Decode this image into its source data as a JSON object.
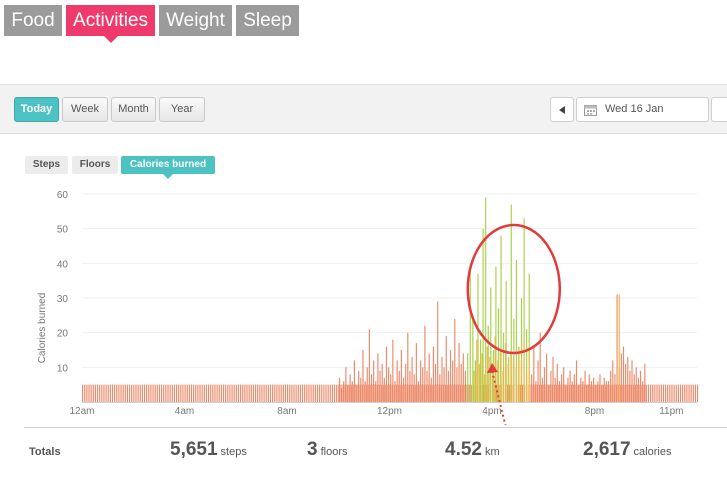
{
  "top_tabs": [
    {
      "label": "Food"
    },
    {
      "label": "Activities",
      "active": true
    },
    {
      "label": "Weight"
    },
    {
      "label": "Sleep"
    }
  ],
  "toolbar": {
    "ranges": [
      "Today",
      "Week",
      "Month",
      "Year"
    ],
    "active_range": "Today",
    "date": "Wed 16 Jan"
  },
  "metric_tabs": [
    "Steps",
    "Floors",
    "Calories burned"
  ],
  "active_metric": "Calories burned",
  "chart_data": {
    "type": "bar",
    "ylabel": "Calories burned",
    "y_ticks": [
      "10",
      "20",
      "30",
      "40",
      "50",
      "60"
    ],
    "ylim": [
      0,
      60
    ],
    "x_tick_labels": [
      "12am",
      "4am",
      "8am",
      "12pm",
      "4pm",
      "8pm",
      "11pm"
    ],
    "x_tick_hours": [
      0,
      4,
      8,
      12,
      16,
      20,
      23
    ],
    "x_range_hours": [
      0,
      24
    ],
    "interval_minutes": 5,
    "baseline_calories": 5,
    "active_periods": [
      {
        "start_hour": 10.0,
        "end_hour": 15.0,
        "color": "#ec8a6a",
        "values": [
          7,
          4,
          6,
          10,
          5,
          8,
          6,
          12,
          5,
          9,
          7,
          15,
          6,
          10,
          21,
          8,
          12,
          6,
          14,
          9,
          11,
          7,
          16,
          10,
          8,
          18,
          6,
          12,
          9,
          15,
          7,
          11,
          20,
          9,
          13,
          8,
          17,
          6,
          12,
          10,
          22,
          9,
          14,
          7,
          16,
          11,
          29,
          8,
          13,
          10,
          19,
          9,
          15,
          12,
          24,
          10,
          17,
          11,
          14,
          9
        ]
      },
      {
        "start_hour": 15.0,
        "end_hour": 17.5,
        "color": "#a8d24a",
        "values": [
          14,
          40,
          25,
          12,
          37,
          18,
          50,
          59,
          22,
          33,
          15,
          39,
          27,
          48,
          20,
          35,
          13,
          57,
          24,
          41,
          16,
          30,
          53,
          21,
          37
        ]
      },
      {
        "start_hour": 15.25,
        "end_hour": 17.5,
        "color": "#f0b84a",
        "values": [
          9,
          18,
          11,
          14,
          8,
          16,
          13,
          10,
          19,
          12,
          15,
          9,
          17,
          11,
          14,
          13,
          10,
          16,
          12,
          18,
          9,
          15
        ]
      },
      {
        "start_hour": 17.5,
        "end_hour": 20.5,
        "color": "#ec8a6a",
        "values": [
          8,
          16,
          6,
          12,
          20,
          7,
          10,
          14,
          5,
          9,
          13,
          7,
          11,
          6,
          8,
          10,
          5,
          7,
          9,
          6,
          8,
          12,
          5,
          7,
          6,
          9,
          5,
          8,
          6,
          7,
          5,
          6,
          8,
          5,
          7,
          6
        ]
      },
      {
        "start_hour": 20.5,
        "end_hour": 22.0,
        "color": "#ec8a6a",
        "values": [
          6,
          9,
          12,
          8,
          31,
          10,
          14,
          16,
          11,
          13,
          9,
          12,
          8,
          10,
          7,
          9,
          6,
          11
        ]
      },
      {
        "start_hour": 20.92,
        "end_hour": 21.0,
        "color": "#f0b84a",
        "values": [
          31
        ]
      }
    ]
  },
  "totals": {
    "label": "Totals",
    "items": [
      {
        "value": "5,651",
        "unit": "steps"
      },
      {
        "value": "3",
        "unit": "floors"
      },
      {
        "value": "4.52",
        "unit": "km"
      },
      {
        "value": "2,617",
        "unit": "calories"
      }
    ]
  },
  "colors": {
    "accent": "#4cc2c2",
    "active_tab": "#ee3b6b",
    "tab_gray": "#9b9b9b",
    "bar_sedentary": "#ec8a6a",
    "bar_active": "#a8d24a",
    "bar_moderate": "#f0b84a",
    "highlight_circle": "#e23b3b"
  }
}
